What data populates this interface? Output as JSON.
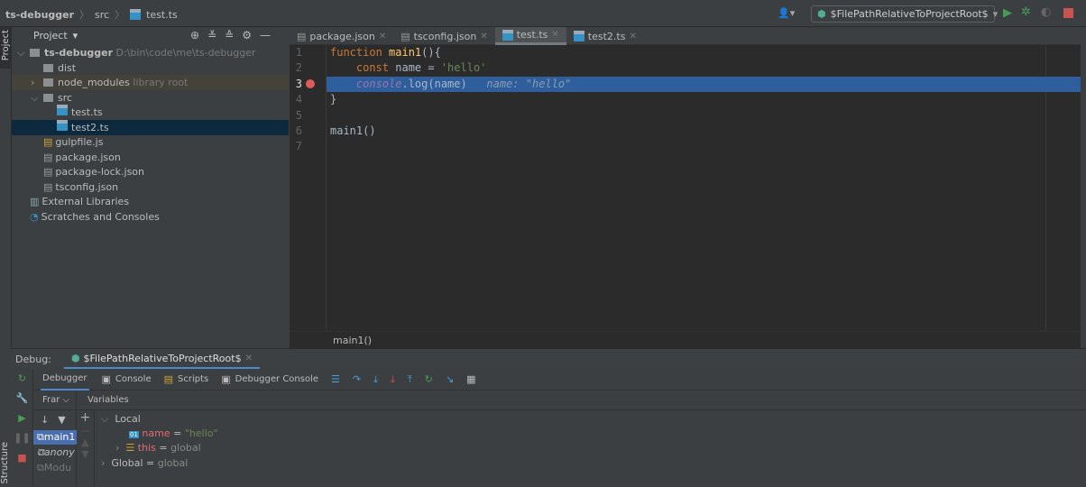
{
  "breadcrumb": [
    "ts-debugger",
    "src",
    "test.ts"
  ],
  "run_config": "$FilePathRelativeToProjectRoot$",
  "left_strip": {
    "project": "Project",
    "structure": "Structure"
  },
  "project": {
    "title": "Project",
    "tree": [
      {
        "label": "ts-debugger",
        "hint": "D:\\bin\\code\\me\\ts-debugger",
        "type": "folder",
        "depth": 0,
        "expanded": true
      },
      {
        "label": "dist",
        "type": "folder",
        "depth": 1
      },
      {
        "label": "node_modules",
        "hint": "library root",
        "type": "folder",
        "depth": 1,
        "collapsed": true
      },
      {
        "label": "src",
        "type": "folder",
        "depth": 1,
        "expanded": true
      },
      {
        "label": "test.ts",
        "type": "ts",
        "depth": 2
      },
      {
        "label": "test2.ts",
        "type": "ts",
        "depth": 2,
        "selected": true
      },
      {
        "label": "gulpfile.js",
        "type": "js",
        "depth": 1
      },
      {
        "label": "package.json",
        "type": "json",
        "depth": 1
      },
      {
        "label": "package-lock.json",
        "type": "json",
        "depth": 1
      },
      {
        "label": "tsconfig.json",
        "type": "json",
        "depth": 1
      },
      {
        "label": "External Libraries",
        "type": "lib",
        "depth": 0
      },
      {
        "label": "Scratches and Consoles",
        "type": "scratch",
        "depth": 0
      }
    ]
  },
  "editor": {
    "tabs": [
      {
        "label": "package.json"
      },
      {
        "label": "tsconfig.json"
      },
      {
        "label": "test.ts",
        "active": true
      },
      {
        "label": "test2.ts"
      }
    ],
    "line_numbers": [
      "1",
      "2",
      "3",
      "4",
      "5",
      "6",
      "7"
    ],
    "breadcrumb": "main1()",
    "inline_hint": "name: \"hello\""
  },
  "debug": {
    "label": "Debug:",
    "session": "$FilePathRelativeToProjectRoot$",
    "tabs": [
      "Debugger",
      "Console",
      "Scripts",
      "Debugger Console"
    ],
    "frames_label": "Frar",
    "variables_label": "Variables",
    "frames": [
      "main1",
      "anony",
      "Modu"
    ],
    "vars": {
      "local": "Local",
      "name": "name",
      "name_val": "\"hello\"",
      "this": "this",
      "this_val": "global",
      "global": "Global",
      "global_val": "global",
      "eq": "="
    }
  }
}
